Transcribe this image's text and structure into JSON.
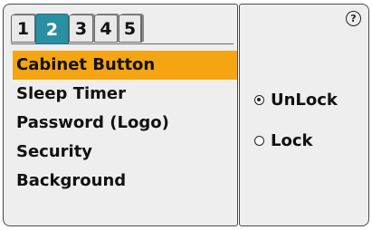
{
  "tabs": [
    {
      "label": "1",
      "active": false
    },
    {
      "label": "2",
      "active": true
    },
    {
      "label": "3",
      "active": false
    },
    {
      "label": "4",
      "active": false
    },
    {
      "label": "5",
      "active": false
    }
  ],
  "menu": {
    "items": [
      {
        "label": "Cabinet Button",
        "selected": true
      },
      {
        "label": "Sleep Timer",
        "selected": false
      },
      {
        "label": "Password (Logo)",
        "selected": false
      },
      {
        "label": "Security",
        "selected": false
      },
      {
        "label": "Background",
        "selected": false
      }
    ]
  },
  "options": {
    "unlock": {
      "label": "UnLock",
      "checked": true
    },
    "lock": {
      "label": "Lock",
      "checked": false
    }
  },
  "help": {
    "icon": "help-icon",
    "glyph": "?"
  },
  "colors": {
    "active_tab": "#2b8fa3",
    "selection": "#f5a511",
    "panel": "#eeeeee"
  }
}
